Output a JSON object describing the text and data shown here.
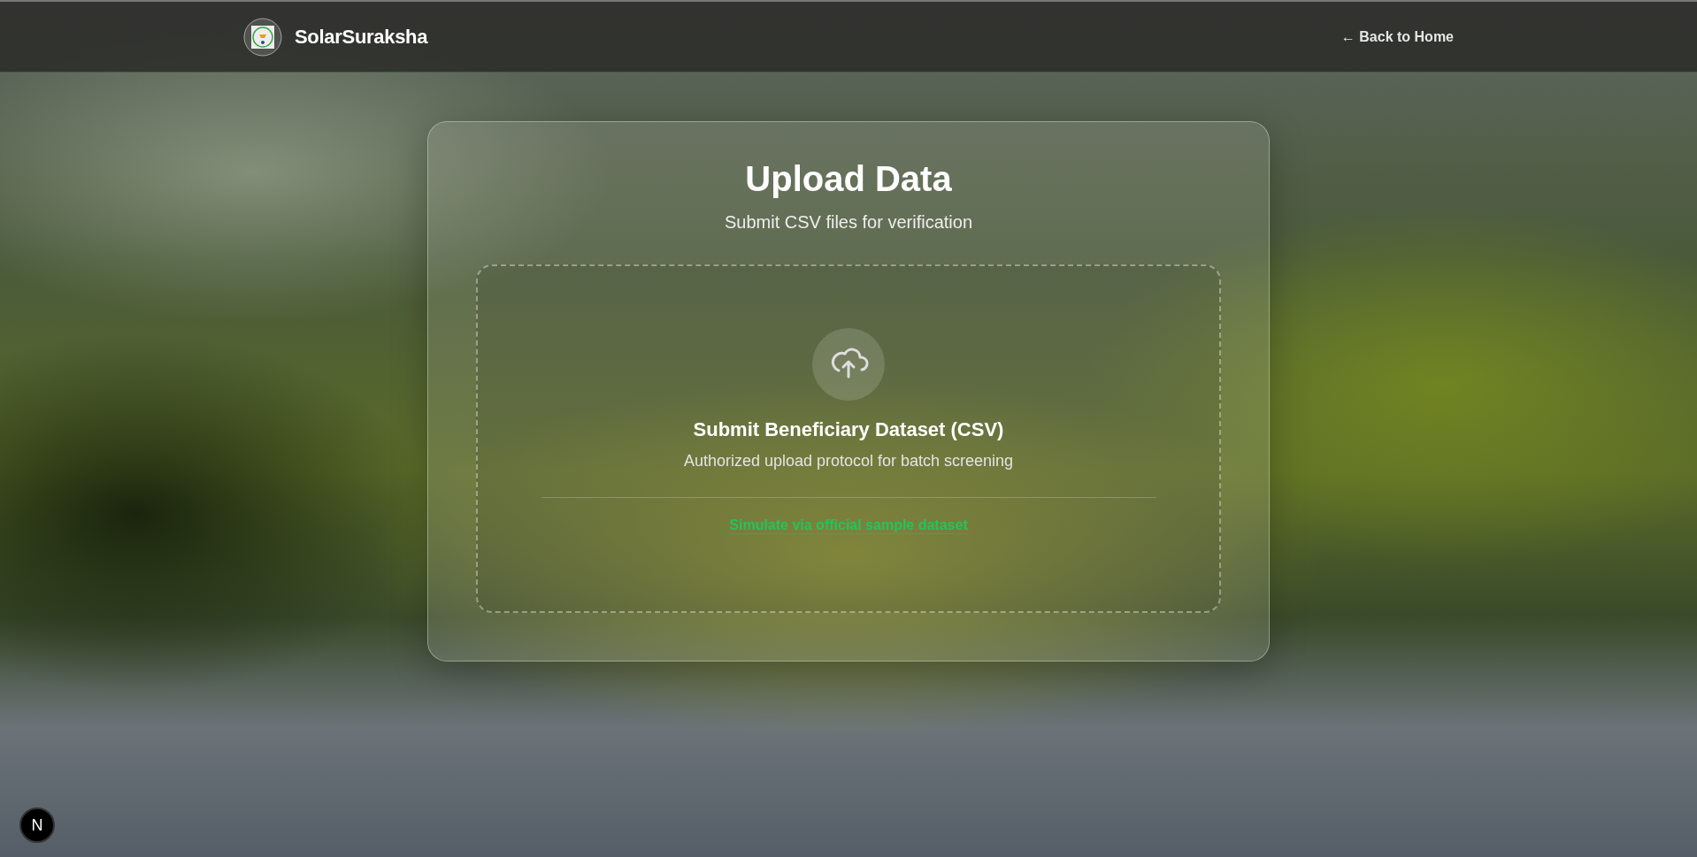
{
  "header": {
    "brand": "SolarSuraksha",
    "back_link": "← Back to Home"
  },
  "card": {
    "title": "Upload Data",
    "subtitle": "Submit CSV files for verification",
    "dropzone": {
      "heading": "Submit Beneficiary Dataset (CSV)",
      "description": "Authorized upload protocol for batch screening",
      "sample_link": "Simulate via official sample dataset"
    }
  },
  "dev_badge": {
    "label": "N"
  }
}
